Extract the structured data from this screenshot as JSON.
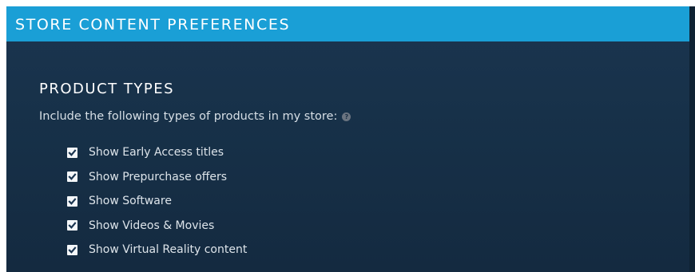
{
  "header": {
    "title": "STORE CONTENT PREFERENCES"
  },
  "section": {
    "title": "PRODUCT TYPES",
    "description": "Include the following types of products in my store:",
    "help_icon": "question-mark-help-icon",
    "help_glyph": "?"
  },
  "options": [
    {
      "label": "Show Early Access titles",
      "checked": true
    },
    {
      "label": "Show Prepurchase offers",
      "checked": true
    },
    {
      "label": "Show Software",
      "checked": true
    },
    {
      "label": "Show Videos & Movies",
      "checked": true
    },
    {
      "label": "Show Virtual Reality content",
      "checked": true
    }
  ],
  "colors": {
    "header_bg": "#1a9fd6",
    "panel_bg": "#173149",
    "text_primary": "#ffffff",
    "text_secondary": "#d7dfe6"
  }
}
